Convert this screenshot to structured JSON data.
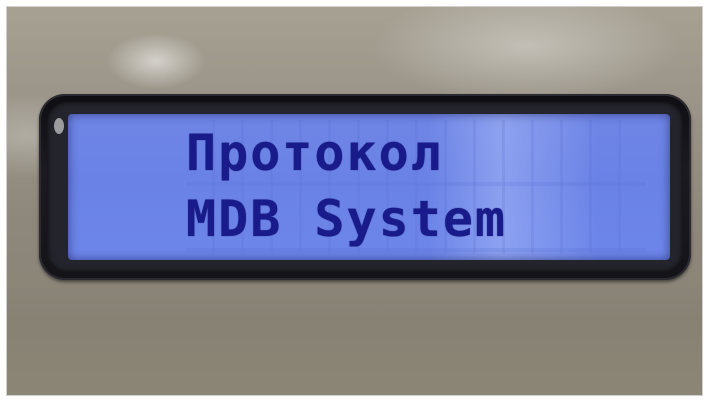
{
  "display": {
    "line1": "Протокол",
    "line2": "MDB System"
  },
  "colors": {
    "lcd_background": "#6a82e6",
    "lcd_text": "#1a1b8a",
    "bezel": "#141418",
    "panel": "#9c968a"
  }
}
